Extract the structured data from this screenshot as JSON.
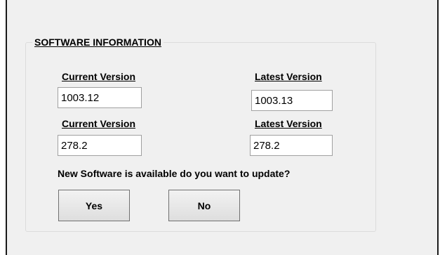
{
  "group": {
    "title": "SOFTWARE INFORMATION"
  },
  "row1": {
    "current_label": "Current Version",
    "current_value": "1003.12",
    "latest_label": "Latest Version",
    "latest_value": "1003.13"
  },
  "row2": {
    "current_label": "Current Version",
    "current_value": "278.2",
    "latest_label": "Latest Version",
    "latest_value": "278.2"
  },
  "prompt": "New Software is available do you want to update?",
  "buttons": {
    "yes": "Yes",
    "no": "No"
  }
}
